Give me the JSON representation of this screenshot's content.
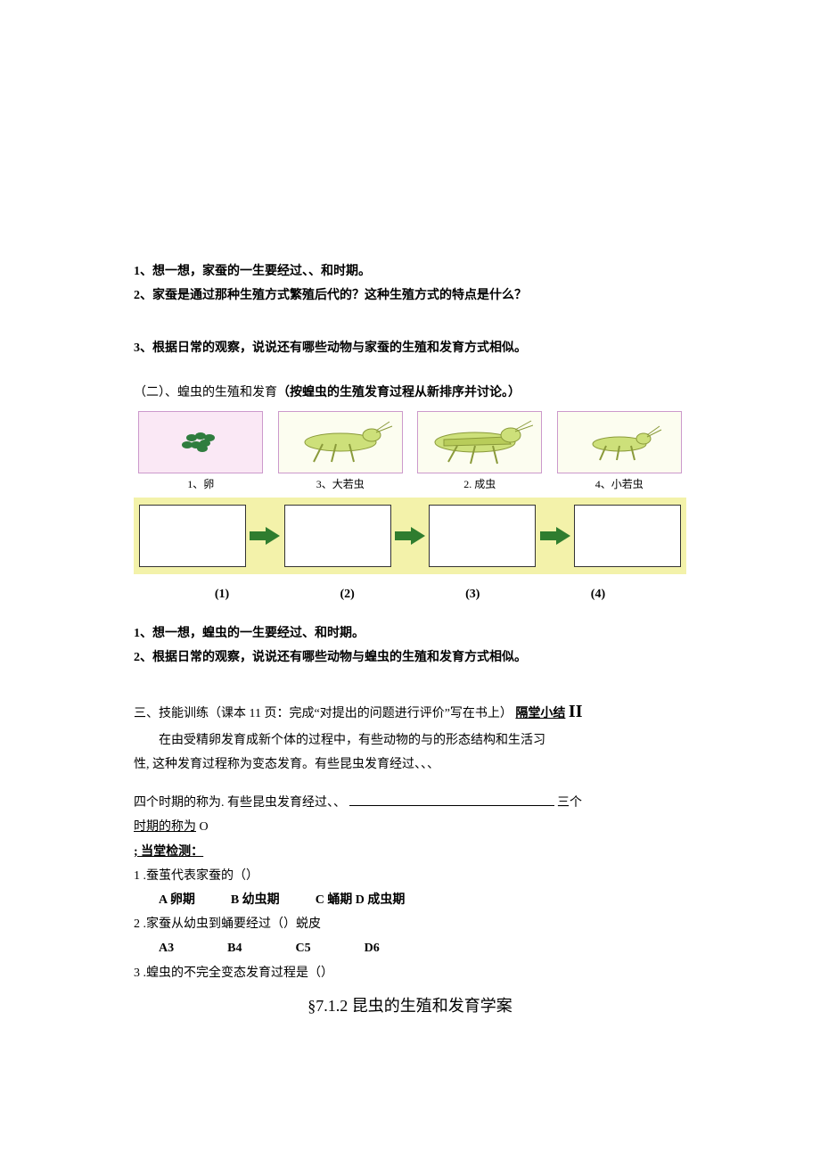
{
  "q1": "1、想一想，家蚕的一生要经过、、和时期。",
  "q2": "2、家蚕是通过那种生殖方式繁殖后代的？这种生殖方式的特点是什么？",
  "q3": "3、根据日常的观察，说说还有哪些动物与家蚕的生殖和发育方式相似。",
  "sec2_lead": "（二）、蝗虫的生殖和发育",
  "sec2_bold": "（按蝗虫的生殖发育过程从新排序并讨论。）",
  "fig_captions": {
    "c1": "1、卵",
    "c2": "3、大若虫",
    "c3": "2. 成虫",
    "c4": "4、小若虫"
  },
  "seq_labels": {
    "l1": "(1)",
    "l2": "(2)",
    "l3": "(3)",
    "l4": "(4)"
  },
  "locust_q1": "1、想一想，蝗虫的一生要经过、和时期。",
  "locust_q2": "2、根据日常的观察，说说还有哪些动物与蝗虫的生殖和发育方式相似。",
  "skill_lead": "三、技能训练（课本 11 页：完成“对提出的问题进行评价”写在书上）",
  "skill_title": "隔堂小结",
  "skill_roman": "II",
  "summary_p1_indent": "　　在由受精卵发育成新个体的过程中，有些动物的与的形态结构和生活习",
  "summary_p2": "性, 这种发育过程称为变态发育。有些昆虫发育经过、、、",
  "summary_p3_a": "四个时期的称为. 有些昆虫发育经过、、",
  "summary_p3_b": "三个",
  "summary_p4_a": "时期的称为",
  "summary_p4_b": " O",
  "test_heading": "; 当堂检测：",
  "test_q1": "1 .蚕茧代表家蚕的（）",
  "test_q1_opts": {
    "a": "A 卵期",
    "b": "B 幼虫期",
    "c": "C 蛹期 D 成虫期"
  },
  "test_q2": "2 .家蚕从幼虫到蛹要经过（）蜕皮",
  "test_q2_opts": {
    "a": "A3",
    "b": "B4",
    "c": "C5",
    "d": "D6"
  },
  "test_q3": "3 .蝗虫的不完全变态发育过程是（）",
  "footer_title": "§7.1.2 昆虫的生殖和发育学案"
}
